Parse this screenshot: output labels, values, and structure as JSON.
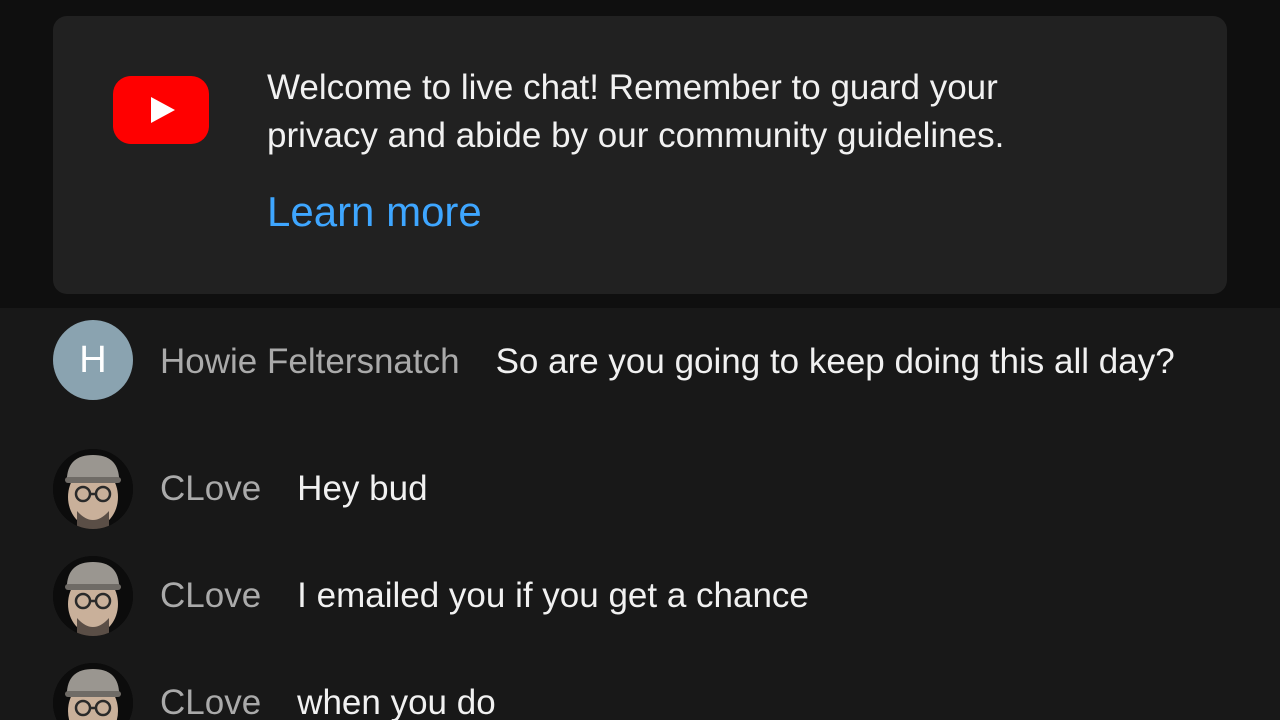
{
  "welcome": {
    "line1": "Welcome to live chat! Remember to guard your",
    "line2": "privacy and abide by our community guidelines.",
    "learn_more": "Learn more",
    "logo_icon": "youtube-logo-icon",
    "link_color": "#3ea6ff"
  },
  "messages": [
    {
      "author": "Howie Feltersnatch",
      "avatar_letter": "H",
      "avatar_color": "#8aa3b0",
      "text": "So are you going to keep doing this all day?"
    },
    {
      "author": "CLove",
      "avatar_icon": "user-photo-avatar",
      "text": "Hey bud"
    },
    {
      "author": "CLove",
      "avatar_icon": "user-photo-avatar",
      "text": "I emailed you if you get a chance"
    },
    {
      "author": "CLove",
      "avatar_icon": "user-photo-avatar",
      "text": "when you do"
    }
  ]
}
